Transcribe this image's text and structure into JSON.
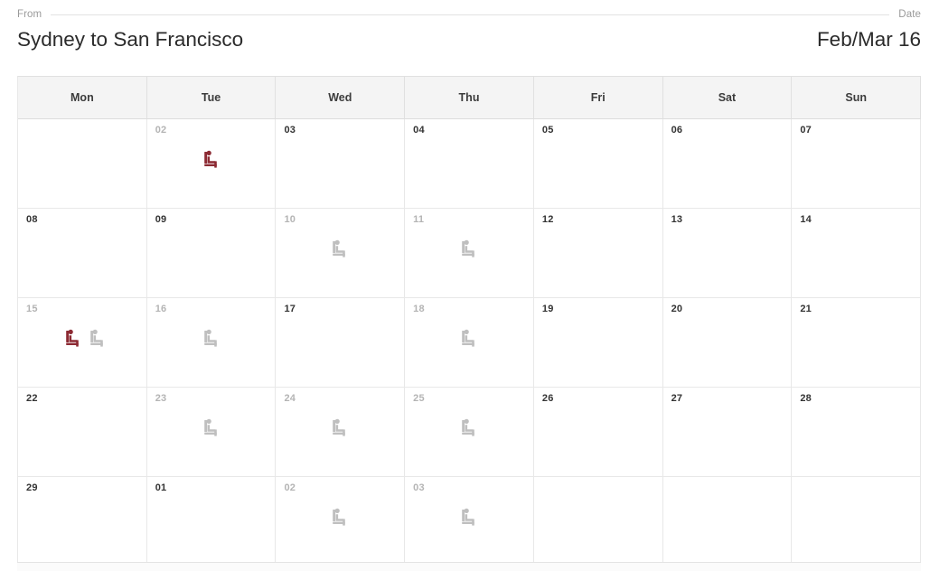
{
  "header": {
    "from_label": "From",
    "date_label": "Date",
    "route_title": "Sydney to San Francisco",
    "date_value": "Feb/Mar 16"
  },
  "colors": {
    "icon_selected": "#8c2a33",
    "icon_available": "#bfbfbf",
    "header_background": "#f4f4f4",
    "active_day_text": "#333333",
    "muted_day_text": "#b4b4b4"
  },
  "calendar": {
    "weekday_headers": [
      "Mon",
      "Tue",
      "Wed",
      "Thu",
      "Fri",
      "Sat",
      "Sun"
    ],
    "weeks": [
      [
        {
          "day": "",
          "state": "empty",
          "icons": []
        },
        {
          "day": "02",
          "state": "muted",
          "icons": [
            "seat-icon-red"
          ]
        },
        {
          "day": "03",
          "state": "active",
          "icons": []
        },
        {
          "day": "04",
          "state": "active",
          "icons": []
        },
        {
          "day": "05",
          "state": "active",
          "icons": []
        },
        {
          "day": "06",
          "state": "active",
          "icons": []
        },
        {
          "day": "07",
          "state": "active",
          "icons": []
        }
      ],
      [
        {
          "day": "08",
          "state": "active",
          "icons": []
        },
        {
          "day": "09",
          "state": "active",
          "icons": []
        },
        {
          "day": "10",
          "state": "muted",
          "icons": [
            "seat-icon-gray"
          ]
        },
        {
          "day": "11",
          "state": "muted",
          "icons": [
            "seat-icon-gray"
          ]
        },
        {
          "day": "12",
          "state": "active",
          "icons": []
        },
        {
          "day": "13",
          "state": "active",
          "icons": []
        },
        {
          "day": "14",
          "state": "active",
          "icons": []
        }
      ],
      [
        {
          "day": "15",
          "state": "muted",
          "icons": [
            "seat-icon-red",
            "seat-icon-gray"
          ]
        },
        {
          "day": "16",
          "state": "muted",
          "icons": [
            "seat-icon-gray"
          ]
        },
        {
          "day": "17",
          "state": "active",
          "icons": []
        },
        {
          "day": "18",
          "state": "muted",
          "icons": [
            "seat-icon-gray"
          ]
        },
        {
          "day": "19",
          "state": "active",
          "icons": []
        },
        {
          "day": "20",
          "state": "active",
          "icons": []
        },
        {
          "day": "21",
          "state": "active",
          "icons": []
        }
      ],
      [
        {
          "day": "22",
          "state": "active",
          "icons": []
        },
        {
          "day": "23",
          "state": "muted",
          "icons": [
            "seat-icon-gray"
          ]
        },
        {
          "day": "24",
          "state": "muted",
          "icons": [
            "seat-icon-gray"
          ]
        },
        {
          "day": "25",
          "state": "muted",
          "icons": [
            "seat-icon-gray"
          ]
        },
        {
          "day": "26",
          "state": "active",
          "icons": []
        },
        {
          "day": "27",
          "state": "active",
          "icons": []
        },
        {
          "day": "28",
          "state": "active",
          "icons": []
        }
      ],
      [
        {
          "day": "29",
          "state": "active",
          "icons": []
        },
        {
          "day": "01",
          "state": "active",
          "icons": []
        },
        {
          "day": "02",
          "state": "muted",
          "icons": [
            "seat-icon-gray"
          ]
        },
        {
          "day": "03",
          "state": "muted",
          "icons": [
            "seat-icon-gray"
          ]
        },
        {
          "day": "",
          "state": "empty",
          "icons": []
        },
        {
          "day": "",
          "state": "empty",
          "icons": []
        },
        {
          "day": "",
          "state": "empty",
          "icons": []
        }
      ]
    ]
  }
}
